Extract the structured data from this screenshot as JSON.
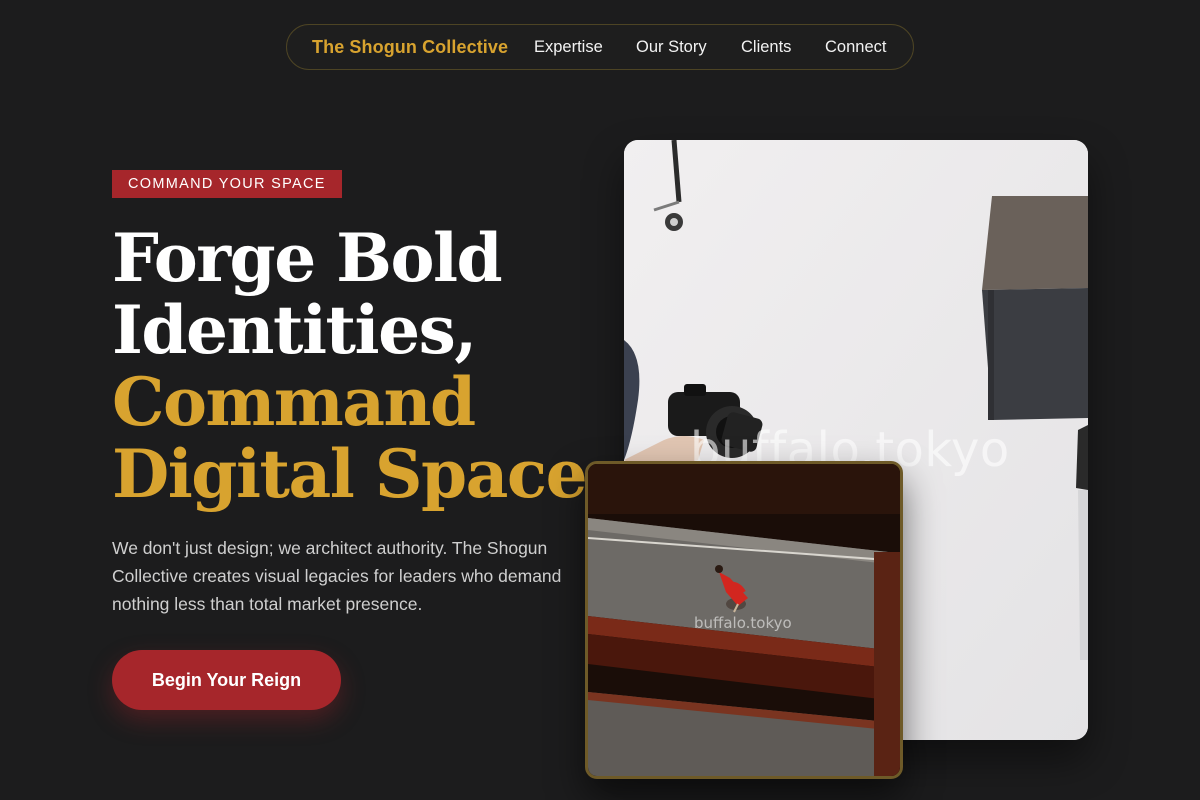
{
  "nav": {
    "brand": "The Shogun Collective",
    "links": [
      "Expertise",
      "Our Story",
      "Clients",
      "Connect"
    ]
  },
  "hero": {
    "tag": "COMMAND YOUR SPACE",
    "headline_lines": [
      "Forge Bold",
      "Identities,",
      "Command",
      "Digital Space."
    ],
    "lede": "We don't just design; we architect authority. The Shogun Collective creates visual legacies for leaders who demand nothing less than total market presence.",
    "cta": "Begin Your Reign"
  },
  "images": {
    "main_watermark": "buffalo.tokyo",
    "inset_watermark": "buffalo.tokyo"
  },
  "colors": {
    "background": "#1c1c1d",
    "accent_gold": "#d8a32f",
    "accent_red": "#a6262b",
    "text_muted": "#cfcfcf"
  }
}
